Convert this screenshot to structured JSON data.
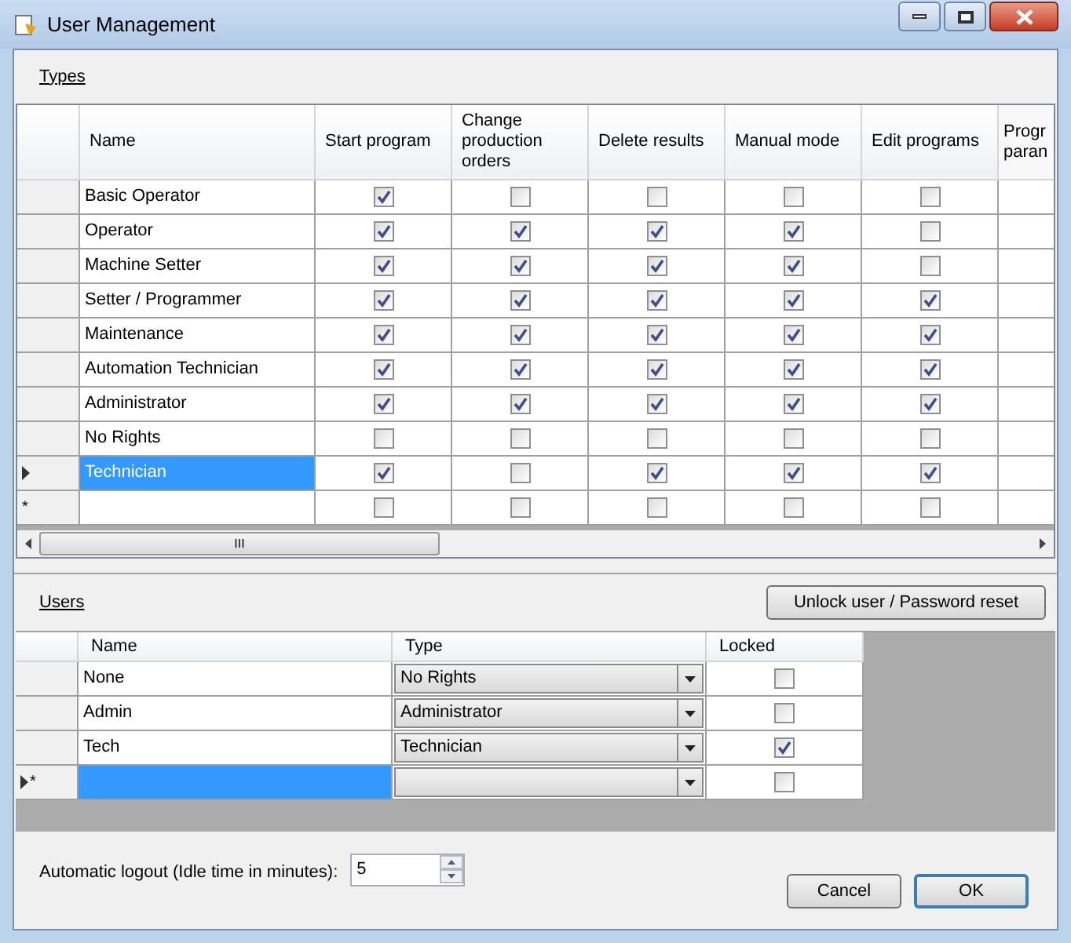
{
  "window": {
    "title": "User Management"
  },
  "types": {
    "label": "Types",
    "columns": [
      "Name",
      "Start program",
      "Change production orders",
      "Delete results",
      "Manual mode",
      "Edit programs"
    ],
    "cut_column": [
      "Progr",
      "paran"
    ],
    "rows": [
      {
        "name": "Basic Operator",
        "selected": false,
        "current": false,
        "perms": [
          true,
          false,
          false,
          false,
          false
        ]
      },
      {
        "name": "Operator",
        "selected": false,
        "current": false,
        "perms": [
          true,
          true,
          true,
          true,
          false
        ]
      },
      {
        "name": "Machine Setter",
        "selected": false,
        "current": false,
        "perms": [
          true,
          true,
          true,
          true,
          false
        ]
      },
      {
        "name": "Setter / Programmer",
        "selected": false,
        "current": false,
        "perms": [
          true,
          true,
          true,
          true,
          true
        ]
      },
      {
        "name": "Maintenance",
        "selected": false,
        "current": false,
        "perms": [
          true,
          true,
          true,
          true,
          true
        ]
      },
      {
        "name": "Automation Technician",
        "selected": false,
        "current": false,
        "perms": [
          true,
          true,
          true,
          true,
          true
        ]
      },
      {
        "name": "Administrator",
        "selected": false,
        "current": false,
        "perms": [
          true,
          true,
          true,
          true,
          true
        ]
      },
      {
        "name": "No Rights",
        "selected": false,
        "current": false,
        "perms": [
          false,
          false,
          false,
          false,
          false
        ]
      },
      {
        "name": "Technician",
        "selected": true,
        "current": true,
        "perms": [
          true,
          false,
          true,
          true,
          true
        ]
      },
      {
        "new_row_mark": "*",
        "selected": false,
        "current": false,
        "perms": [
          false,
          false,
          false,
          false,
          false
        ]
      }
    ],
    "scrollbar_grip": "III"
  },
  "users": {
    "label": "Users",
    "unlock_button": "Unlock user / Password reset",
    "columns": [
      "Name",
      "Type",
      "Locked"
    ],
    "rows": [
      {
        "name": "None",
        "type": "No Rights",
        "locked": false,
        "selected": false,
        "current": false
      },
      {
        "name": "Admin",
        "type": "Administrator",
        "locked": false,
        "selected": false,
        "current": false
      },
      {
        "name": "Tech",
        "type": "Technician",
        "locked": true,
        "selected": false,
        "current": false
      },
      {
        "new_row_mark": "*",
        "selected": true,
        "current": true,
        "locked": false
      }
    ]
  },
  "logout": {
    "label": "Automatic logout (Idle time in minutes):",
    "value": "5"
  },
  "buttons": [
    {
      "label": "Cancel",
      "default": false
    },
    {
      "label": "OK",
      "default": true
    }
  ]
}
